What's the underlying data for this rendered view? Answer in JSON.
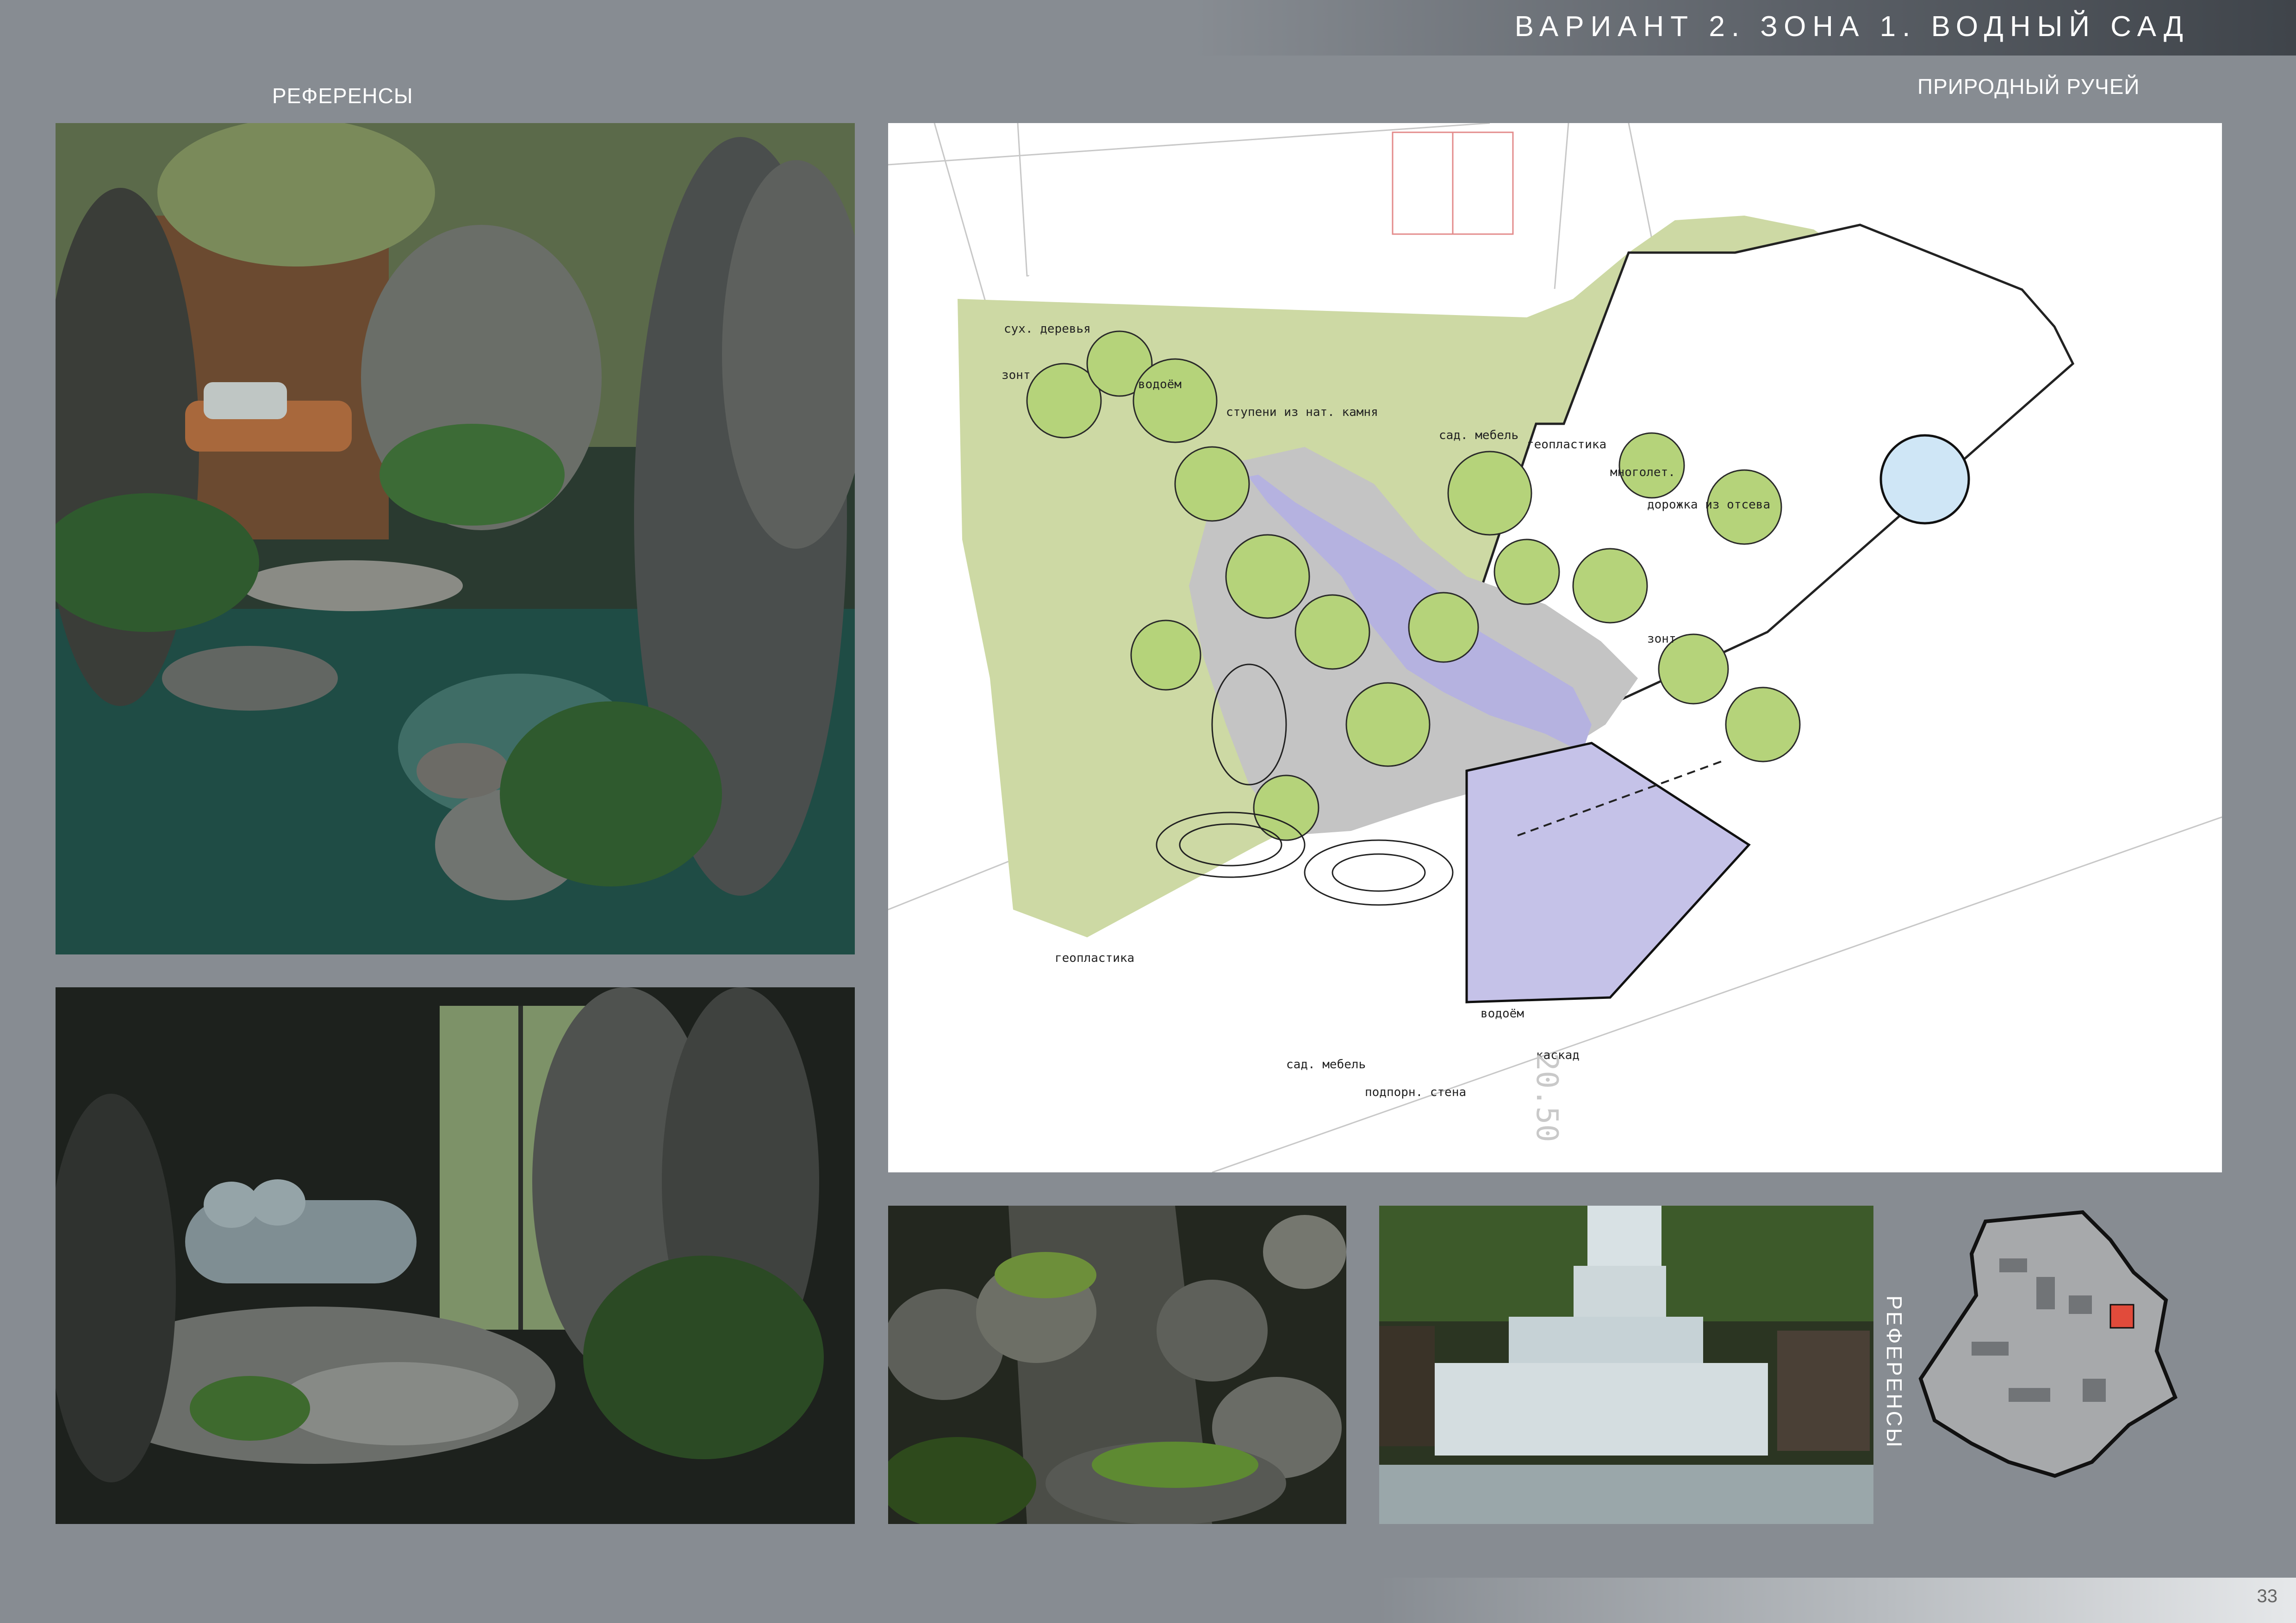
{
  "header": {
    "title": "ВАРИАНТ 2. ЗОНА 1. ВОДНЫЙ САД"
  },
  "labels": {
    "references_top": "РЕФЕРЕНСЫ",
    "plan_title": "ПРИРОДНЫЙ РУЧЕЙ",
    "references_side": "РЕФЕРЕНСЫ"
  },
  "plan_annotations": {
    "dry_trees": "сух. деревья",
    "pond_top": "водоём",
    "steps": "ступени из нат. камня",
    "garden_furniture_top": "сад. мебель",
    "geoplastic_top": "геопластика",
    "perennials": "многолет.",
    "path": "дорожка из отсева",
    "zone_left": "зонт",
    "zone_right": "зонт",
    "geoplastic_bottom": "геопластика",
    "pond_bottom": "водоём",
    "cascade": "каскад",
    "garden_furniture_bottom": "сад. мебель",
    "retaining_wall": "подпорн. стена",
    "dimension": "20.50"
  },
  "footer": {
    "page_number": "33"
  }
}
